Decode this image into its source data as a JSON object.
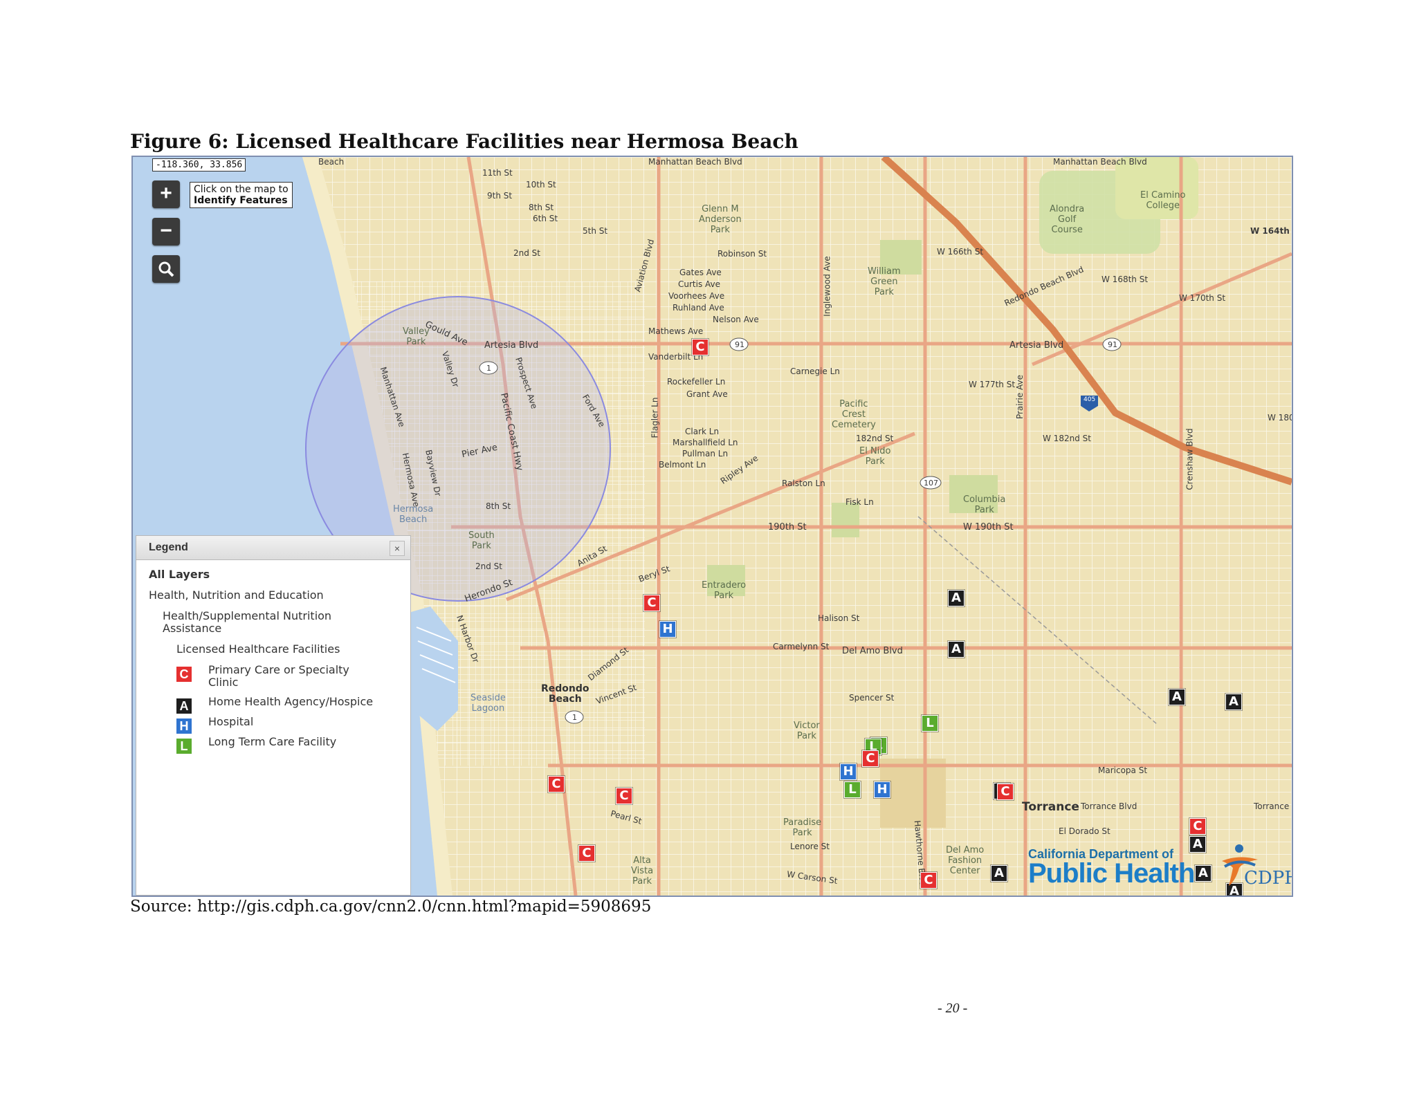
{
  "figure_title": "Figure 6:  Licensed Healthcare Facilities near Hermosa Beach",
  "map": {
    "coordinates": "-118.360, 33.856",
    "zoom_in": "+",
    "zoom_out": "−",
    "tooltip": {
      "line1": "Click on the map to",
      "line2": "Identify Features"
    },
    "labels": {
      "manhattan_beach_blvd": "Manhattan Beach Blvd",
      "manhattan_beach_blvd_e": "Manhattan Beach Blvd",
      "beach": "Beach",
      "st11": "11th St",
      "st10": "10th St",
      "st9": "9th St",
      "st8": "8th St",
      "st6": "6th St",
      "st5": "5th St",
      "st2": "2nd St",
      "glenn": "Glenn M\nAnderson\nPark",
      "robinson": "Robinson St",
      "gates": "Gates Ave",
      "curtis": "Curtis Ave",
      "voorhees": "Voorhees Ave",
      "ruhland": "Ruhland Ave",
      "nelson": "Nelson Ave",
      "mathews": "Mathews Ave",
      "vanderbilt": "Vanderbilt Ln",
      "rockefeller": "Rockefeller Ln",
      "grant": "Grant Ave",
      "carnegie": "Carnegie Ln",
      "clark": "Clark Ln",
      "marshallfield": "Marshallfield Ln",
      "pullman": "Pullman Ln",
      "belmont": "Belmont Ln",
      "ripley": "Ripley Ave",
      "ralston": "Ralston Ln",
      "fisk": "Fisk Ln",
      "artesia_w": "Artesia  Blvd",
      "artesia_e": "Artesia  Blvd",
      "gould": "Gould Ave",
      "valley_park": "Valley\nPark",
      "pier": "Pier Ave",
      "pch": "Pacific Coast Hwy",
      "prospect": "Prospect Ave",
      "ford": "Ford Ave",
      "hermosa_ave": "Hermosa Ave",
      "bayview": "Bayview Dr",
      "valley_dr": "Valley Dr",
      "manhattan_ave": "Manhattan Ave",
      "hermosa_beach": "Hermosa\nBeach",
      "south_park": "South\nPark",
      "st8b": "8th St",
      "st2b": "2nd St",
      "herondo": "Herondo St",
      "anita": "Anita St",
      "beryl": "Beryl St",
      "entradero": "Entradero\nPark",
      "st190": "190th St",
      "w190": "W 190th St",
      "columbia": "Columbia\nPark",
      "halison": "Halison St",
      "carmelynn": "Carmelynn St",
      "del_amo": "Del Amo Blvd",
      "spencer": "Spencer St",
      "victor_park": "Victor\nPark",
      "redondo_beach": "Redondo\nBeach",
      "seaside": "Seaside\nLagoon",
      "vincent": "Vincent St",
      "diamond": "Diamond St",
      "torrance": "Torrance",
      "torrance_blvd": "Torrance Blvd",
      "torrance_e": "Torrance",
      "el_dorado": "El Dorado St",
      "maricopa": "Maricopa St",
      "paradise": "Paradise\nPark",
      "lenore": "Lenore St",
      "carson": "W Carson St",
      "del_amo_fashion": "Del Amo\nFashion\nCenter",
      "alta_vista": "Alta\nVista\nPark",
      "pearl": "Pearl St",
      "pacific_crest": "Pacific\nCrest\nCemetery",
      "st182": "182nd St",
      "w182": "W 182nd St",
      "el_nido": "El Nido\nPark",
      "w177": "W 177th St",
      "w166": "W 166th St",
      "w164": "W 164th",
      "w168": "W 168th St",
      "w170": "W 170th St",
      "w180": "W 180",
      "redondo_beach_blvd": "Redondo Beach Blvd",
      "alondra": "Alondra\nGolf\nCourse",
      "el_camino": "El Camino\nCollege",
      "william_green": "William\nGreen\nPark",
      "aviation": "Aviation Blvd",
      "inglewood": "Inglewood Ave",
      "hawthorne": "Hawthorne Blvd",
      "prairie": "Prairie Ave",
      "crenshaw": "Crenshaw Blvd",
      "n_harbor": "N Harbor Dr",
      "flagler": "Flagler Ln",
      "hwy91": "91",
      "hwy91b": "91",
      "hwy1": "1",
      "hwy1b": "1",
      "hwy107": "107",
      "i405": "405"
    },
    "markers": [
      {
        "type": "C",
        "x": 0.489,
        "y": 0.257
      },
      {
        "type": "C",
        "x": 0.447,
        "y": 0.603
      },
      {
        "type": "H",
        "x": 0.461,
        "y": 0.639
      },
      {
        "type": "A",
        "x": 0.71,
        "y": 0.596
      },
      {
        "type": "A",
        "x": 0.71,
        "y": 0.666
      },
      {
        "type": "L",
        "x": 0.687,
        "y": 0.766
      },
      {
        "type": "L",
        "x": 0.643,
        "y": 0.796
      },
      {
        "type": "L",
        "x": 0.638,
        "y": 0.798
      },
      {
        "type": "C",
        "x": 0.636,
        "y": 0.814
      },
      {
        "type": "H",
        "x": 0.617,
        "y": 0.831
      },
      {
        "type": "L",
        "x": 0.62,
        "y": 0.856
      },
      {
        "type": "H",
        "x": 0.646,
        "y": 0.856
      },
      {
        "type": "A",
        "x": 0.749,
        "y": 0.858
      },
      {
        "type": "C",
        "x": 0.752,
        "y": 0.859
      },
      {
        "type": "A",
        "x": 0.9,
        "y": 0.73
      },
      {
        "type": "A",
        "x": 0.949,
        "y": 0.737
      },
      {
        "type": "C",
        "x": 0.365,
        "y": 0.848
      },
      {
        "type": "C",
        "x": 0.423,
        "y": 0.864
      },
      {
        "type": "C",
        "x": 0.391,
        "y": 0.942
      },
      {
        "type": "C",
        "x": 0.918,
        "y": 0.905
      },
      {
        "type": "A",
        "x": 0.918,
        "y": 0.93
      },
      {
        "type": "A",
        "x": 0.747,
        "y": 0.969
      },
      {
        "type": "C",
        "x": 0.686,
        "y": 0.978
      },
      {
        "type": "A",
        "x": 0.923,
        "y": 0.969
      },
      {
        "type": "A",
        "x": 0.95,
        "y": 0.993
      }
    ]
  },
  "legend": {
    "title": "Legend",
    "close": "×",
    "all_layers": "All Layers",
    "group": "Health, Nutrition and Education",
    "subgroup": "Health/Supplemental Nutrition\nAssistance",
    "layer": "Licensed Healthcare Facilities",
    "items": [
      {
        "icon": "C",
        "label": "Primary Care or Specialty\nClinic",
        "color": "#e53030"
      },
      {
        "icon": "A",
        "label": "Home Health Agency/Hospice",
        "color": "#1e1e1e"
      },
      {
        "icon": "H",
        "label": "Hospital",
        "color": "#2f74d0"
      },
      {
        "icon": "L",
        "label": "Long Term Care Facility",
        "color": "#5aac2e"
      }
    ]
  },
  "logo": {
    "line1": "California Department of",
    "line2": "Public Health",
    "line3": "CDPH"
  },
  "source": "Source: http://gis.cdph.ca.gov/cnn2.0/cnn.html?mapid=5908695",
  "page_number": "- 20 -",
  "colors": {
    "land": "#efe3b8",
    "water": "#b9d3ee",
    "major_road": "#e9a685",
    "freeway": "#d9834f",
    "clinic": "#e53030",
    "home_health": "#1e1e1e",
    "hospital": "#2f74d0",
    "long_term": "#5aac2e"
  }
}
